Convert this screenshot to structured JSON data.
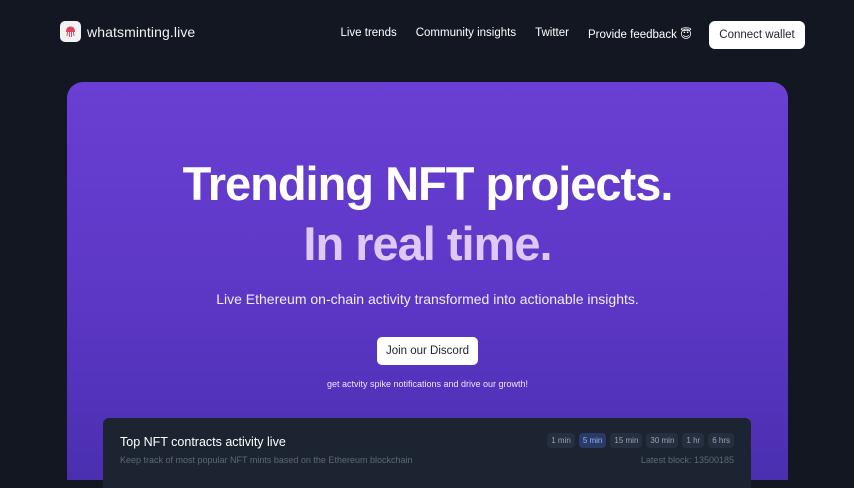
{
  "header": {
    "logo_text": "whatsminting.live",
    "nav": [
      {
        "label": "Live trends"
      },
      {
        "label": "Community insights"
      },
      {
        "label": "Twitter"
      },
      {
        "label": "Provide feedback 😇"
      }
    ],
    "connect_label": "Connect wallet"
  },
  "hero": {
    "title": "Trending NFT projects.",
    "subtitle": "In real time.",
    "description": "Live Ethereum on-chain activity transformed into actionable insights.",
    "discord_label": "Join our Discord",
    "note": "get actvity spike notifications and drive our growth!"
  },
  "activity_panel": {
    "title": "Top NFT contracts activity live",
    "description": "Keep track of most popular NFT mints based on the Ethereum blockchain",
    "latest_block": "Latest block: 13500185",
    "ranges": [
      {
        "label": "1 min"
      },
      {
        "label": "5 min",
        "active": true
      },
      {
        "label": "15 min"
      },
      {
        "label": "30 min"
      },
      {
        "label": "1 hr"
      },
      {
        "label": "6 hrs"
      }
    ]
  },
  "colors": {
    "hero_gradient_top": "#6a3fd3",
    "hero_gradient_bottom": "#4a2fb0",
    "subtitle": "#ddc8f6",
    "page_background": "#121722",
    "panel_background": "#1c2432"
  }
}
